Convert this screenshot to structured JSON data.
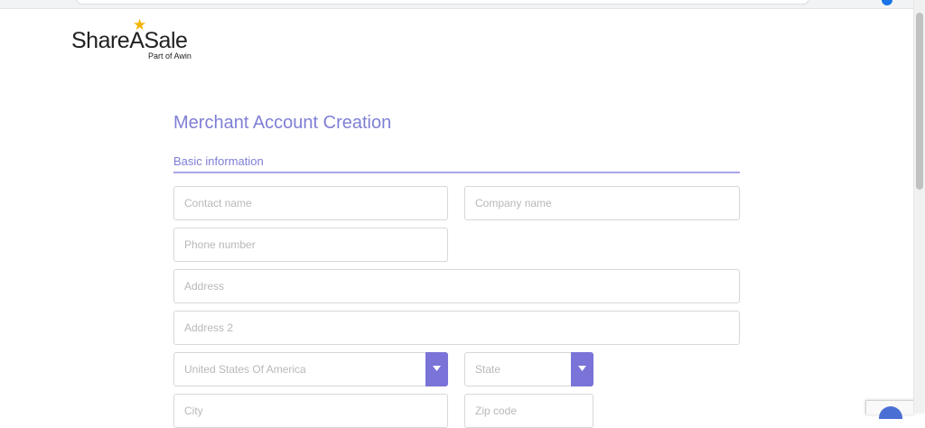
{
  "logo": {
    "brand": "ShareASale",
    "tagline": "Part of Awin"
  },
  "page": {
    "title": "Merchant Account Creation",
    "section": "Basic information"
  },
  "form": {
    "contact_name": {
      "placeholder": "Contact name",
      "value": ""
    },
    "company_name": {
      "placeholder": "Company name",
      "value": ""
    },
    "phone_number": {
      "placeholder": "Phone number",
      "value": ""
    },
    "address": {
      "placeholder": "Address",
      "value": ""
    },
    "address2": {
      "placeholder": "Address 2",
      "value": ""
    },
    "country": {
      "selected": "United States Of America"
    },
    "state": {
      "selected": "State"
    },
    "city": {
      "placeholder": "City",
      "value": ""
    },
    "zip": {
      "placeholder": "Zip code",
      "value": ""
    }
  },
  "colors": {
    "accent": "#7a73d8",
    "heading": "#7f7fd5",
    "star": "#f5b400"
  },
  "icons": {
    "logo_star": "star-icon",
    "dropdown": "chevron-down-icon"
  }
}
